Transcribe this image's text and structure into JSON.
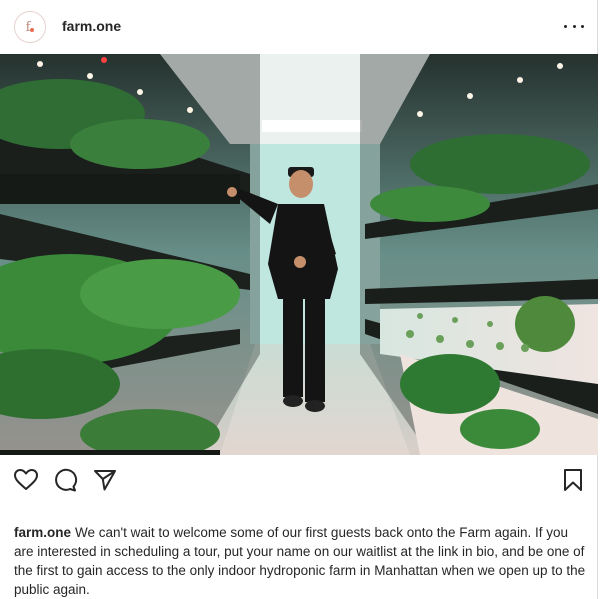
{
  "post": {
    "username": "farm.one",
    "avatar_text": "f.o",
    "more_icon": "ellipsis-icon",
    "photo_alt": "farm.one indoor hydroponic farm photo"
  },
  "actions": {
    "like_icon": "heart-icon",
    "comment_icon": "comment-bubble-icon",
    "share_icon": "paper-plane-icon",
    "save_icon": "bookmark-icon"
  },
  "caption": {
    "username": "farm.one",
    "text": "We can't wait to welcome some of our first guests back onto the Farm again. If you are interested in scheduling a tour, put your name on our waitlist at the link in bio, and be one of the first to gain access to the only indoor hydroponic farm in Manhattan when we open up to the public again."
  },
  "colors": {
    "text": "#262626",
    "border": "#dbdbdb",
    "avatar_accent": "#e86a53"
  }
}
